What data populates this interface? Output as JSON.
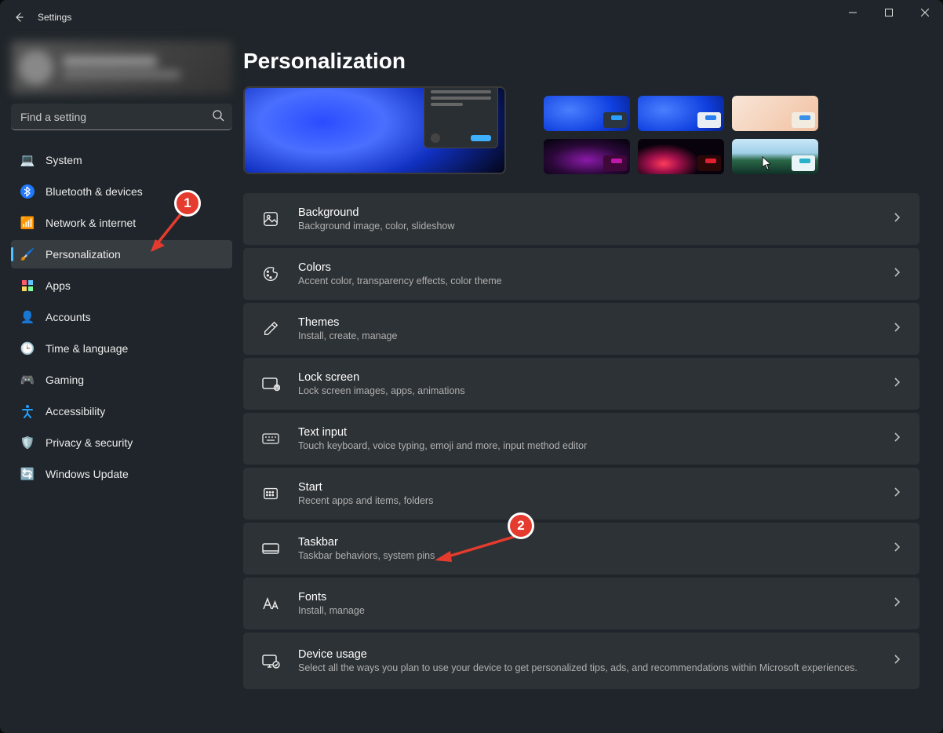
{
  "window": {
    "title": "Settings"
  },
  "search": {
    "placeholder": "Find a setting"
  },
  "nav": [
    {
      "id": "system",
      "label": "System",
      "icon": "💻"
    },
    {
      "id": "bluetooth",
      "label": "Bluetooth & devices",
      "icon": "bt"
    },
    {
      "id": "network",
      "label": "Network & internet",
      "icon": "📶"
    },
    {
      "id": "personalization",
      "label": "Personalization",
      "icon": "🖌️",
      "active": true
    },
    {
      "id": "apps",
      "label": "Apps",
      "icon": "▦"
    },
    {
      "id": "accounts",
      "label": "Accounts",
      "icon": "👤"
    },
    {
      "id": "time",
      "label": "Time & language",
      "icon": "🕒"
    },
    {
      "id": "gaming",
      "label": "Gaming",
      "icon": "🎮"
    },
    {
      "id": "accessibility",
      "label": "Accessibility",
      "icon": "acc"
    },
    {
      "id": "privacy",
      "label": "Privacy & security",
      "icon": "🛡️"
    },
    {
      "id": "update",
      "label": "Windows Update",
      "icon": "🔄"
    }
  ],
  "page": {
    "title": "Personalization"
  },
  "rows": [
    {
      "id": "background",
      "title": "Background",
      "sub": "Background image, color, slideshow"
    },
    {
      "id": "colors",
      "title": "Colors",
      "sub": "Accent color, transparency effects, color theme"
    },
    {
      "id": "themes",
      "title": "Themes",
      "sub": "Install, create, manage"
    },
    {
      "id": "lockscreen",
      "title": "Lock screen",
      "sub": "Lock screen images, apps, animations"
    },
    {
      "id": "textinput",
      "title": "Text input",
      "sub": "Touch keyboard, voice typing, emoji and more, input method editor"
    },
    {
      "id": "start",
      "title": "Start",
      "sub": "Recent apps and items, folders"
    },
    {
      "id": "taskbar",
      "title": "Taskbar",
      "sub": "Taskbar behaviors, system pins"
    },
    {
      "id": "fonts",
      "title": "Fonts",
      "sub": "Install, manage"
    },
    {
      "id": "deviceusage",
      "title": "Device usage",
      "sub": "Select all the ways you plan to use your device to get personalized tips, ads, and recommendations within Microsoft experiences."
    }
  ],
  "annotations": {
    "badge1": "1",
    "badge2": "2"
  }
}
